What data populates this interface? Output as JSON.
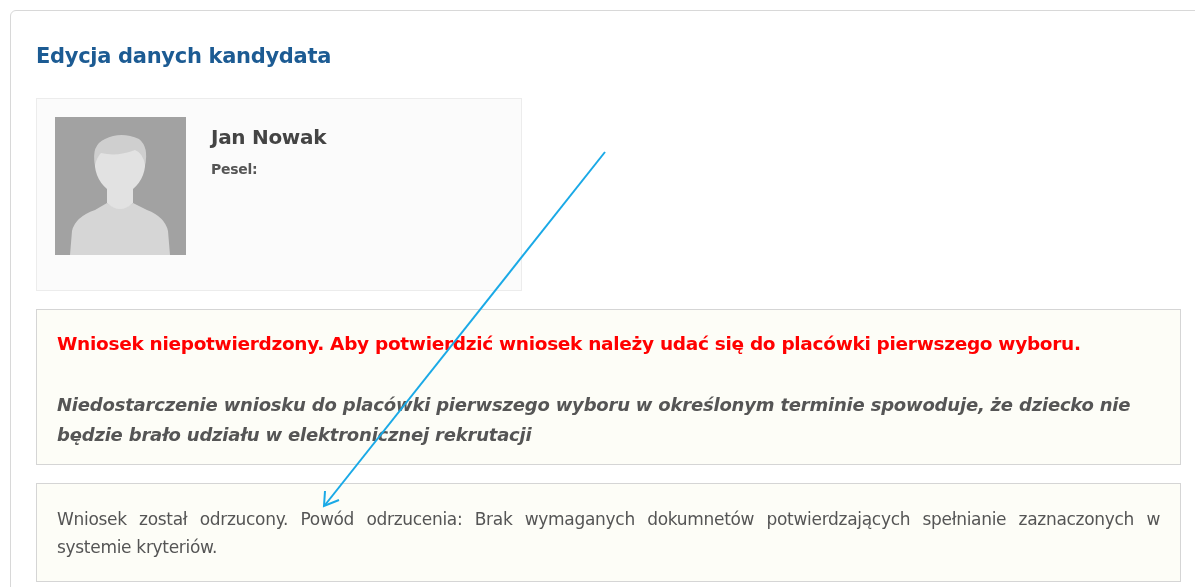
{
  "panel": {
    "title": "Edycja danych kandydata"
  },
  "candidate": {
    "name": "Jan Nowak",
    "pesel_label": "Pesel:"
  },
  "warning": {
    "headline": "Wniosek niepotwierdzony. Aby potwierdzić wniosek należy udać się do placówki pierwszego wyboru.",
    "note": "Niedostarczenie wniosku do placówki pierwszego wyboru w określonym terminie spowoduje, że dziecko nie będzie brało udziału w elektronicznej rekrutacji"
  },
  "rejection": {
    "text": "Wniosek został odrzucony. Powód odrzucenia: Brak wymaganych dokumnetów potwierdzających spełnianie zaznaczonych w systemie kryteriów."
  }
}
